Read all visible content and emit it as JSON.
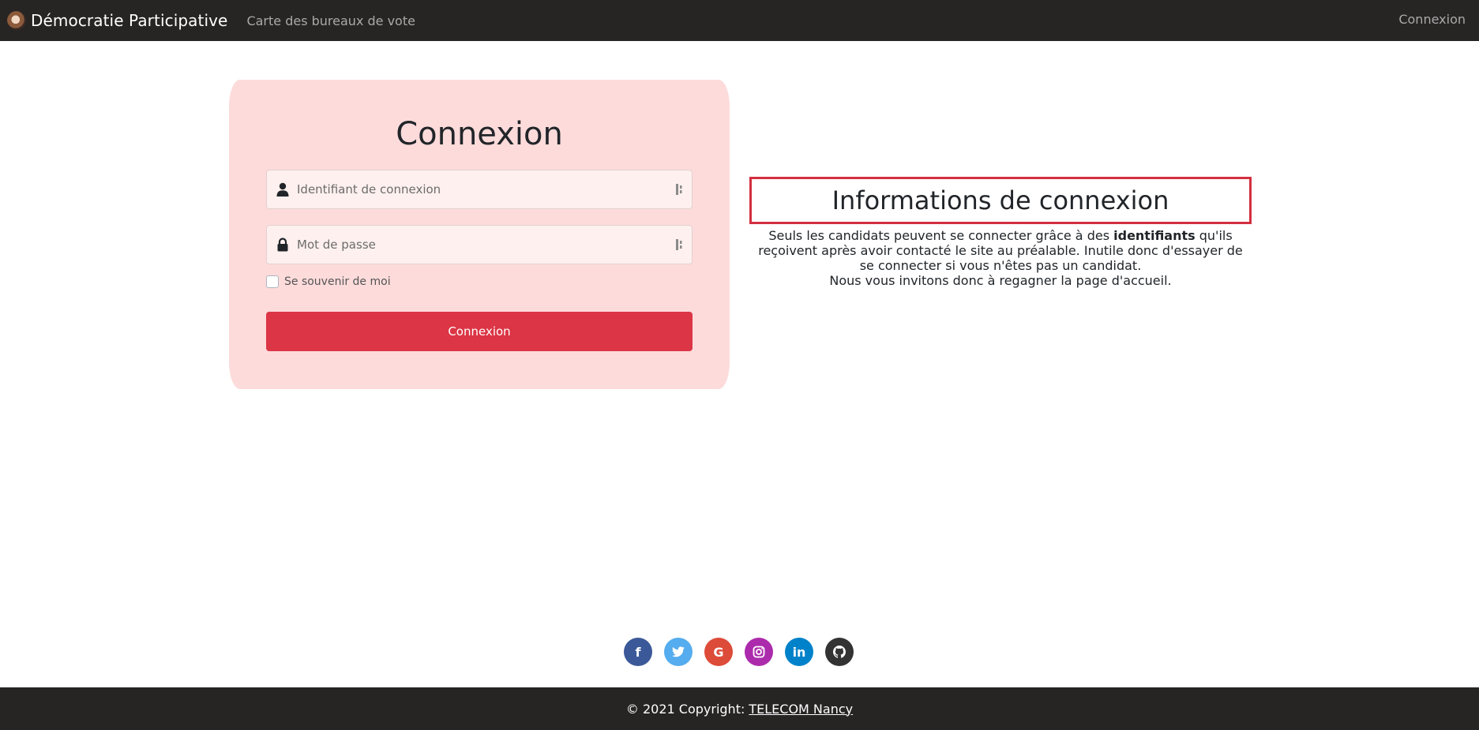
{
  "navbar": {
    "brand": "Démocratie Participative",
    "link_map": "Carte des bureaux de vote",
    "link_login": "Connexion"
  },
  "login": {
    "title": "Connexion",
    "username_placeholder": "Identifiant de connexion",
    "password_placeholder": "Mot de passe",
    "remember_label": "Se souvenir de moi",
    "submit_label": "Connexion"
  },
  "info": {
    "title": "Informations de connexion",
    "text_part1": "Seuls les candidats peuvent se connecter grâce à des ",
    "text_bold": "identifiants",
    "text_part2": " qu'ils reçoivent après avoir contacté le site au préalable. Inutile donc d'essayer de se connecter si vous n'êtes pas un candidat.",
    "text_line2": "Nous vous invitons donc à regagner la page d'accueil."
  },
  "socials": [
    {
      "icon": "facebook-icon",
      "glyph": "f",
      "color": "#3b5998"
    },
    {
      "icon": "twitter-icon",
      "glyph": "🐦",
      "color": "#55acee"
    },
    {
      "icon": "google-icon",
      "glyph": "G",
      "color": "#dd4b39"
    },
    {
      "icon": "instagram-icon",
      "glyph": "◎",
      "color": "#ac2bac"
    },
    {
      "icon": "linkedin-icon",
      "glyph": "in",
      "color": "#0082ca"
    },
    {
      "icon": "github-icon",
      "glyph": "●",
      "color": "#333333"
    }
  ],
  "footer": {
    "copyright": "© 2021 Copyright:",
    "link": "TELECOM Nancy"
  },
  "colors": {
    "navbar_bg": "#272424",
    "card_bg": "#fddbdb",
    "accent_red": "#dc3545"
  }
}
